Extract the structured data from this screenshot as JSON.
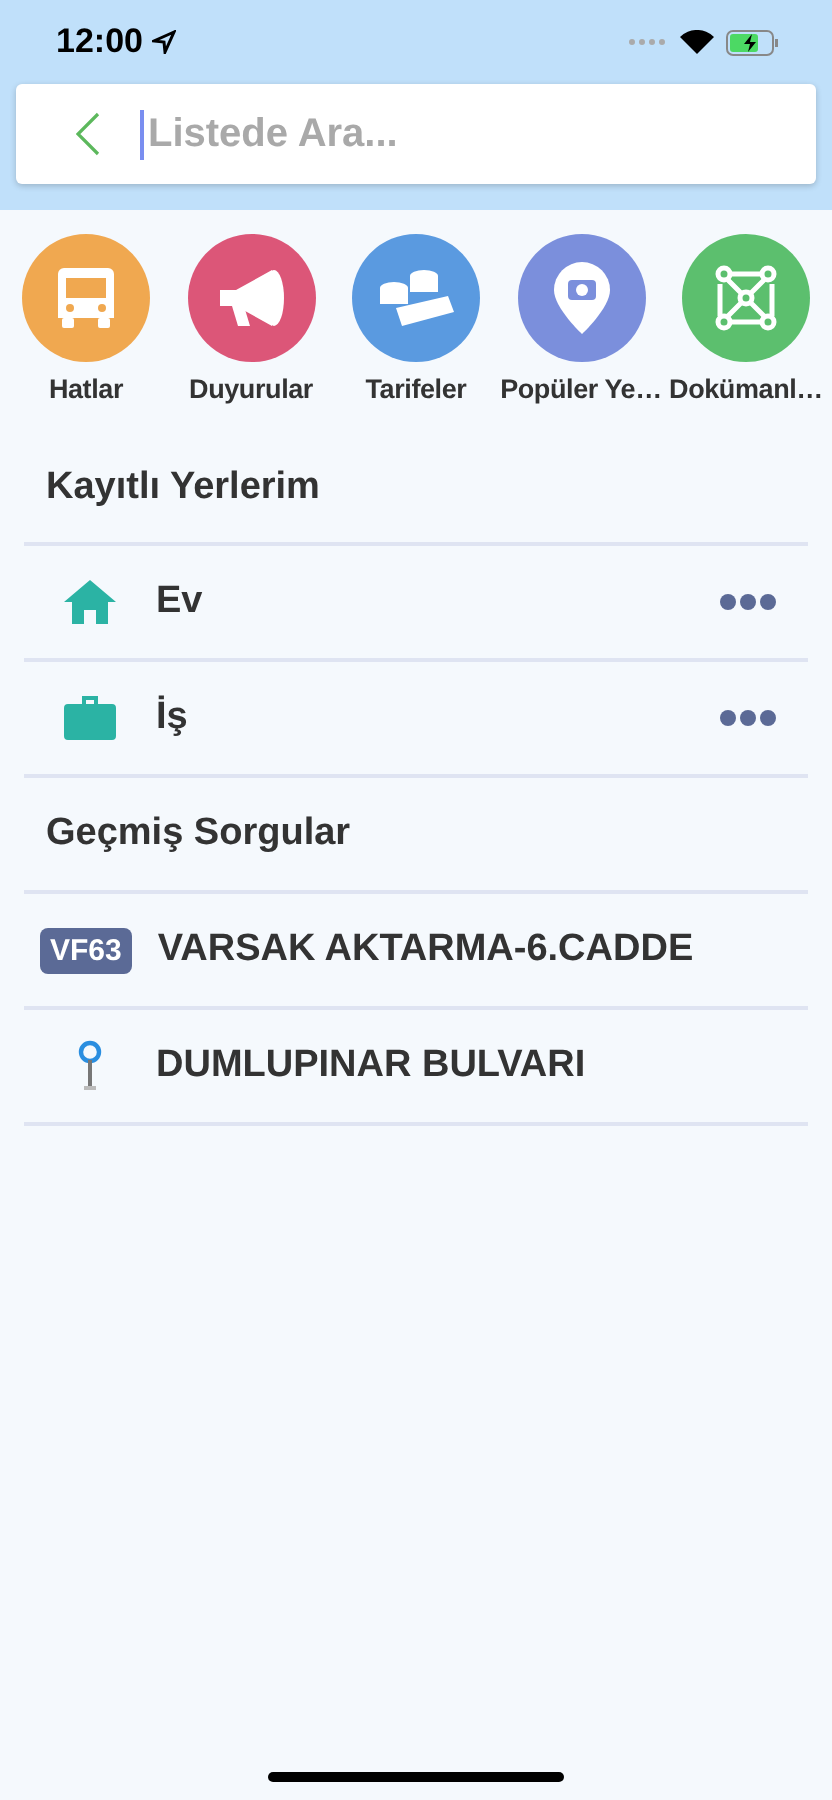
{
  "status_bar": {
    "time": "12:00"
  },
  "search": {
    "placeholder": "Listede Ara..."
  },
  "shortcuts": [
    {
      "kind": "bus",
      "label": "Hatlar",
      "color": "#f0a850"
    },
    {
      "kind": "megaphone",
      "label": "Duyurular",
      "color": "#dc5678"
    },
    {
      "kind": "coins",
      "label": "Tarifeler",
      "color": "#5a9ae0"
    },
    {
      "kind": "pin",
      "label": "Popüler Ye…",
      "color": "#7b8fdc"
    },
    {
      "kind": "network",
      "label": "Dokümanl…",
      "color": "#5cbf6e"
    }
  ],
  "saved_places": {
    "title": "Kayıtlı Yerlerim",
    "items": [
      {
        "kind": "home",
        "label": "Ev"
      },
      {
        "kind": "work",
        "label": "İş"
      }
    ]
  },
  "history": {
    "title": "Geçmiş Sorgular",
    "items": [
      {
        "kind": "line",
        "badge": "VF63",
        "label": "VARSAK AKTARMA-6.CADDE"
      },
      {
        "kind": "stop",
        "label": "DUMLUPINAR BULVARI"
      }
    ]
  }
}
